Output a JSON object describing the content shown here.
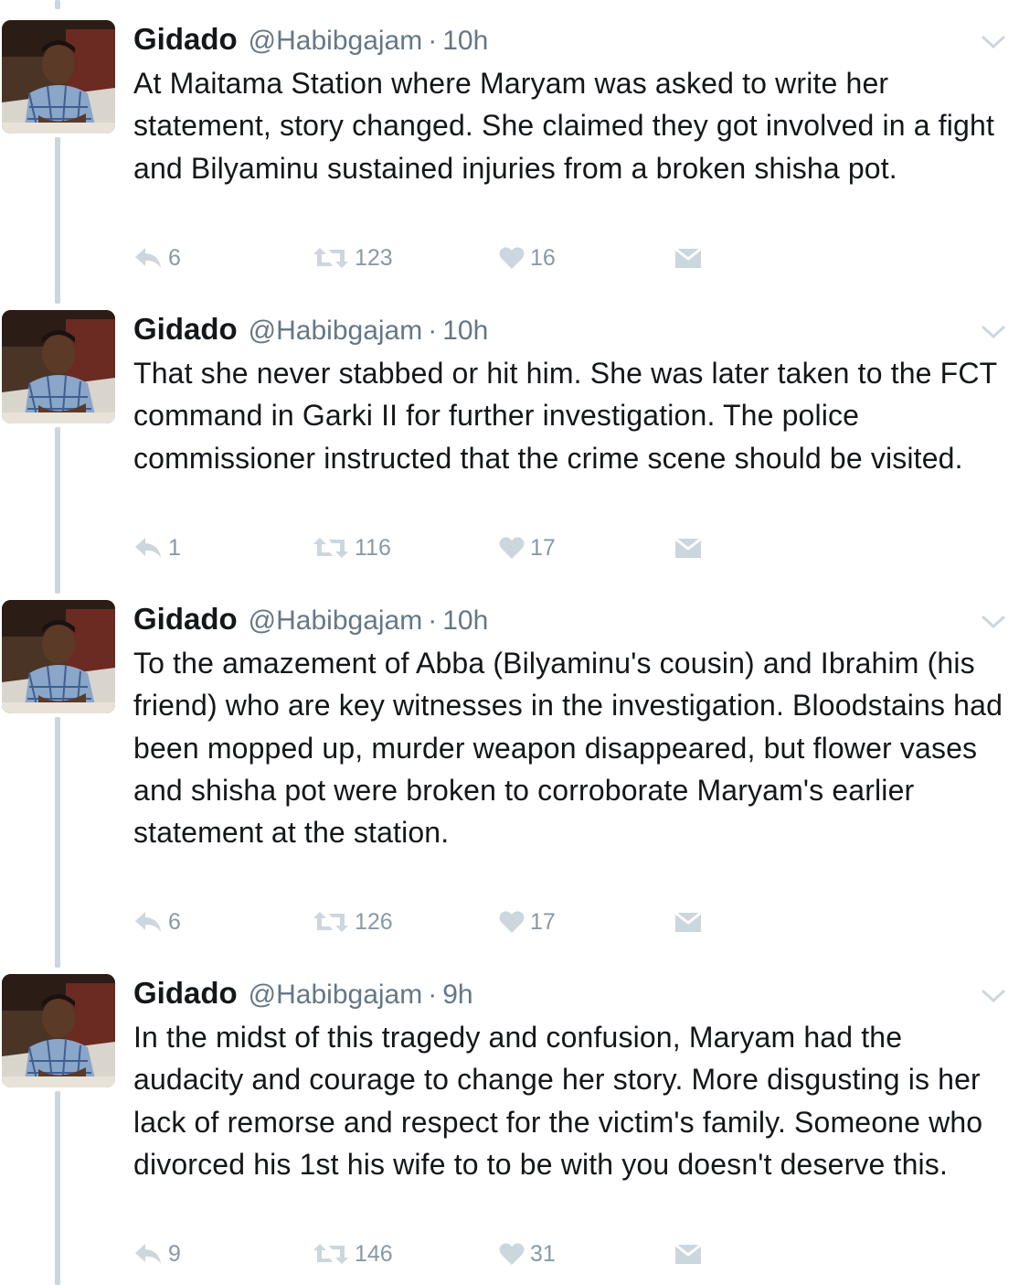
{
  "colors": {
    "text": "#14171a",
    "muted": "#657786",
    "icon": "#ccd6dd",
    "thread": "#ccd6dd"
  },
  "tweets": [
    {
      "name": "Gidado",
      "handle": "@Habibgajam",
      "separator": "·",
      "time": "10h",
      "text": "At Maitama Station where Maryam was asked to write her statement, story changed. She claimed they got involved in a fight and Bilyaminu sustained injuries from a broken shisha pot.",
      "replies": "6",
      "retweets": "123",
      "likes": "16"
    },
    {
      "name": "Gidado",
      "handle": "@Habibgajam",
      "separator": "·",
      "time": "10h",
      "text": "That she never stabbed or hit him. She was later taken to the FCT command in Garki II for further investigation. The police commissioner instructed that the crime scene should be visited.",
      "replies": "1",
      "retweets": "116",
      "likes": "17"
    },
    {
      "name": "Gidado",
      "handle": "@Habibgajam",
      "separator": "·",
      "time": "10h",
      "text": "To the amazement of Abba (Bilyaminu's cousin) and Ibrahim (his friend) who are key witnesses in the investigation. Bloodstains had been mopped up, murder weapon disappeared, but flower vases and shisha pot were broken to corroborate Maryam's earlier statement at the station.",
      "replies": "6",
      "retweets": "126",
      "likes": "17"
    },
    {
      "name": "Gidado",
      "handle": "@Habibgajam",
      "separator": "·",
      "time": "9h",
      "text": "In the midst of this tragedy and confusion, Maryam had the audacity and courage to change her story. More disgusting is her lack of remorse and respect for the victim's family. Someone who divorced his 1st his wife to to be with you doesn't deserve this.",
      "replies": "9",
      "retweets": "146",
      "likes": "31"
    }
  ]
}
